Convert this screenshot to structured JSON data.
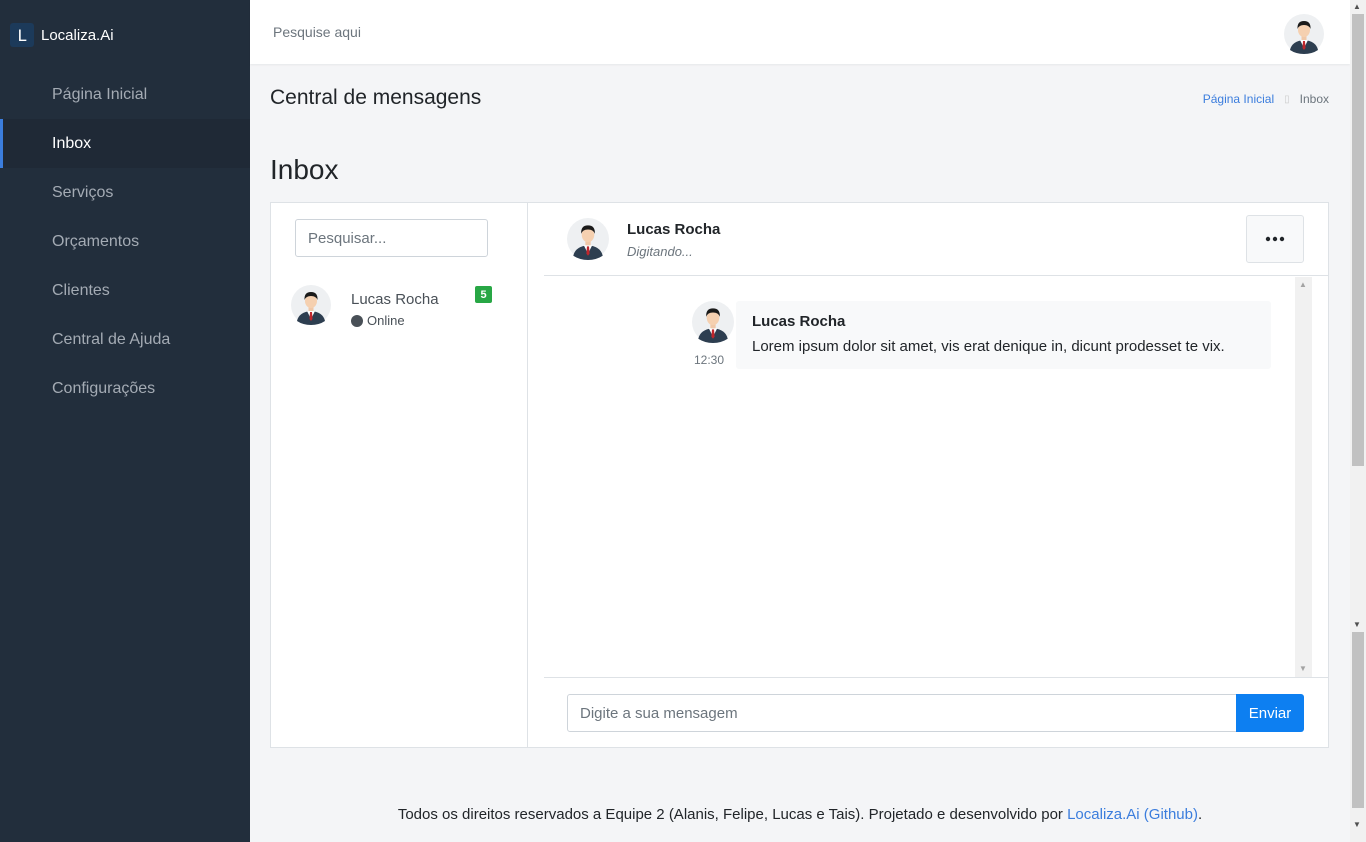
{
  "brand": {
    "logo_letter": "L",
    "name": "Localiza.Ai"
  },
  "sidebar": {
    "items": [
      {
        "label": "Página Inicial"
      },
      {
        "label": "Inbox"
      },
      {
        "label": "Serviços"
      },
      {
        "label": "Orçamentos"
      },
      {
        "label": "Clientes"
      },
      {
        "label": "Central de Ajuda"
      },
      {
        "label": "Configurações"
      }
    ],
    "active_index": 1
  },
  "topbar": {
    "search_placeholder": "Pesquise aqui"
  },
  "header": {
    "title": "Central de mensagens",
    "breadcrumb": {
      "home": "Página Inicial",
      "current": "Inbox"
    }
  },
  "page_title": "Inbox",
  "contacts": {
    "search_placeholder": "Pesquisar...",
    "items": [
      {
        "name": "Lucas Rocha",
        "status": "Online",
        "unread": "5"
      }
    ]
  },
  "chat": {
    "name": "Lucas Rocha",
    "typing": "Digitando...",
    "messages": [
      {
        "author": "Lucas Rocha",
        "time": "12:30",
        "text": "Lorem ipsum dolor sit amet, vis erat denique in, dicunt prodesset te vix."
      }
    ],
    "input_placeholder": "Digite a sua mensagem",
    "send_label": "Enviar"
  },
  "footer": {
    "text": "Todos os direitos reservados a Equipe 2 (Alanis, Felipe, Lucas e Tais). Projetado e desenvolvido por ",
    "link": "Localiza.Ai (Github)",
    "end": "."
  },
  "colors": {
    "sidebar_bg": "#222e3c",
    "accent": "#3b7ddd",
    "send_button": "#0d7ff1",
    "badge": "#28a745"
  },
  "icons": {
    "avatar": "person-avatar-icon",
    "more": "ellipsis-icon"
  }
}
